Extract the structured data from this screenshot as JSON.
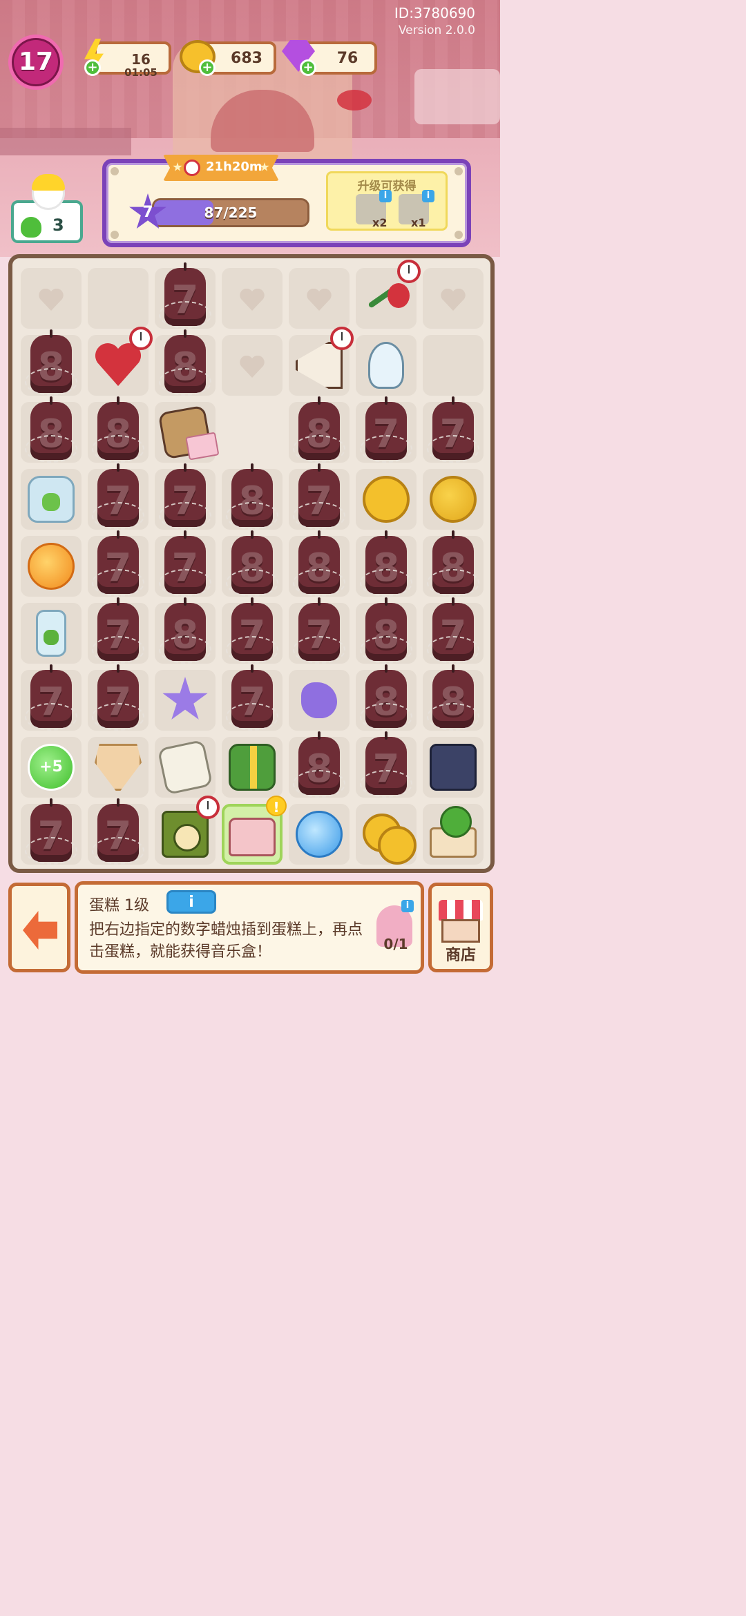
{
  "header": {
    "player_id": "ID:3780690",
    "version": "Version 2.0.0",
    "level": "17"
  },
  "resources": {
    "energy": {
      "value": "16",
      "timer": "01:05",
      "icon": "lightning-bolt-icon"
    },
    "coins": {
      "value": "683",
      "icon": "gold-coin-icon"
    },
    "gems": {
      "value": "76",
      "icon": "purple-gem-icon"
    }
  },
  "progress_panel": {
    "time_left": "21h20m",
    "star_level": "7",
    "xp_text": "87/225",
    "xp_fraction": 0.387,
    "reward_title": "升级可获得",
    "rewards": [
      {
        "qty": "x2",
        "icon": "stone-fragment-icon"
      },
      {
        "qty": "x1",
        "icon": "stone-pillar-icon"
      }
    ]
  },
  "helper": {
    "clover_count": "3"
  },
  "board": {
    "rows": [
      [
        {
          "t": "heart"
        },
        {
          "t": "blank"
        },
        {
          "t": "candle",
          "n": "7"
        },
        {
          "t": "heart"
        },
        {
          "t": "heart"
        },
        {
          "t": "rose",
          "timer": true
        },
        {
          "t": "heart"
        }
      ],
      [
        {
          "t": "candle",
          "n": "8"
        },
        {
          "t": "broken-heart",
          "timer": true
        },
        {
          "t": "candle",
          "n": "8"
        },
        {
          "t": "heart"
        },
        {
          "t": "megaphone",
          "timer": true
        },
        {
          "t": "bulb"
        },
        {
          "t": "blank"
        }
      ],
      [
        {
          "t": "candle",
          "n": "8"
        },
        {
          "t": "candle",
          "n": "8"
        },
        {
          "t": "photo-book"
        },
        {
          "t": "empty"
        },
        {
          "t": "candle",
          "n": "8"
        },
        {
          "t": "candle",
          "n": "7"
        },
        {
          "t": "candle",
          "n": "7"
        }
      ],
      [
        {
          "t": "jar"
        },
        {
          "t": "candle",
          "n": "7"
        },
        {
          "t": "candle",
          "n": "7"
        },
        {
          "t": "candle",
          "n": "8"
        },
        {
          "t": "candle",
          "n": "7"
        },
        {
          "t": "coin"
        },
        {
          "t": "coin-pile"
        }
      ],
      [
        {
          "t": "energy-orb"
        },
        {
          "t": "candle",
          "n": "7"
        },
        {
          "t": "candle",
          "n": "7"
        },
        {
          "t": "candle",
          "n": "8"
        },
        {
          "t": "candle",
          "n": "8"
        },
        {
          "t": "candle",
          "n": "8"
        },
        {
          "t": "candle",
          "n": "8"
        }
      ],
      [
        {
          "t": "bottle"
        },
        {
          "t": "candle",
          "n": "7"
        },
        {
          "t": "candle",
          "n": "8"
        },
        {
          "t": "candle",
          "n": "7"
        },
        {
          "t": "candle",
          "n": "7"
        },
        {
          "t": "candle",
          "n": "8"
        },
        {
          "t": "candle",
          "n": "7"
        }
      ],
      [
        {
          "t": "candle",
          "n": "7"
        },
        {
          "t": "candle",
          "n": "7"
        },
        {
          "t": "star"
        },
        {
          "t": "candle",
          "n": "7"
        },
        {
          "t": "blob"
        },
        {
          "t": "candle",
          "n": "8"
        },
        {
          "t": "candle",
          "n": "8"
        }
      ],
      [
        {
          "t": "plus5",
          "label": "+5"
        },
        {
          "t": "bouquet"
        },
        {
          "t": "paper"
        },
        {
          "t": "gift"
        },
        {
          "t": "candle",
          "n": "8"
        },
        {
          "t": "candle",
          "n": "7"
        },
        {
          "t": "tower"
        }
      ],
      [
        {
          "t": "candle",
          "n": "7"
        },
        {
          "t": "candle",
          "n": "7"
        },
        {
          "t": "clock",
          "timer": true
        },
        {
          "t": "cake",
          "excl": true
        },
        {
          "t": "energy-blue"
        },
        {
          "t": "coins2"
        },
        {
          "t": "cactus-pot"
        }
      ]
    ]
  },
  "info": {
    "title": "蛋糕 1级",
    "info_button": "i",
    "description": "把右边指定的数字蜡烛插到蛋糕上，再点击蛋糕，就能获得音乐盒！",
    "required_count": "0/1",
    "required_info": "i"
  },
  "shop": {
    "label": "商店"
  },
  "colors": {
    "board_border": "#7a5a44",
    "panel_border": "#7b42b8",
    "level_badge": "#c2297a",
    "info_button": "#3ba6e8"
  }
}
